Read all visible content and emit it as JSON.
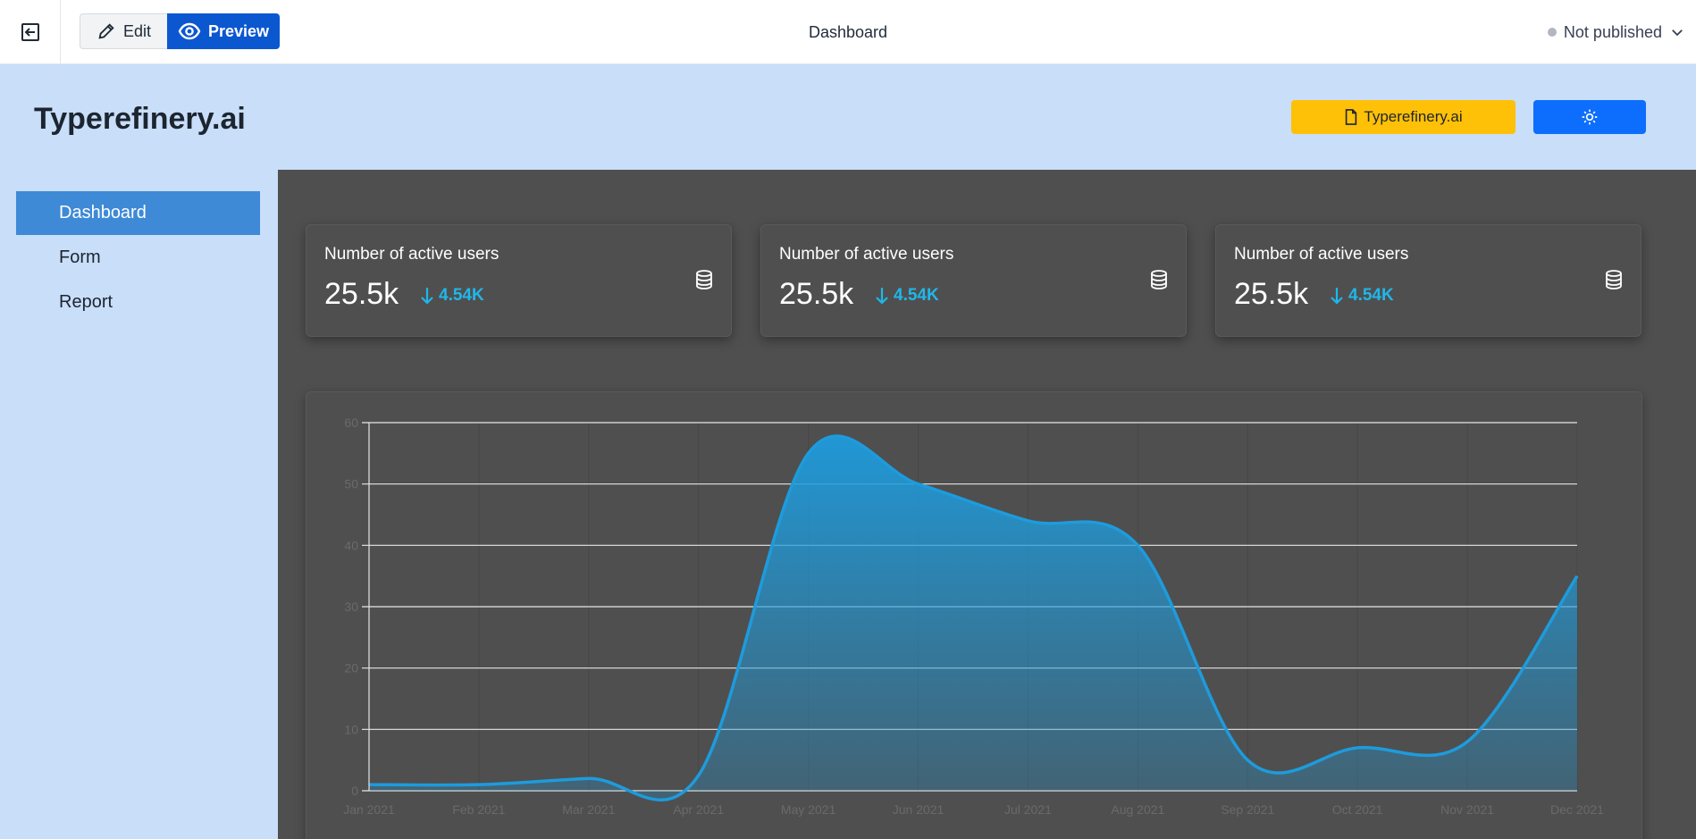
{
  "toolbar": {
    "edit_label": "Edit",
    "preview_label": "Preview",
    "page_title": "Dashboard",
    "publish_status": "Not published"
  },
  "header": {
    "app_title": "Typerefinery.ai",
    "doc_button_label": "Typerefinery.ai"
  },
  "sidebar": {
    "items": [
      {
        "label": "Dashboard",
        "active": true
      },
      {
        "label": "Form",
        "active": false
      },
      {
        "label": "Report",
        "active": false
      }
    ]
  },
  "stats": [
    {
      "label": "Number of active users",
      "value": "25.5k",
      "trend": "4.54K",
      "icon": "database-icon"
    },
    {
      "label": "Number of active users",
      "value": "25.5k",
      "trend": "4.54K",
      "icon": "database-icon"
    },
    {
      "label": "Number of active users",
      "value": "25.5k",
      "trend": "4.54K",
      "icon": "database-icon"
    }
  ],
  "colors": {
    "accent": "#0b57d0",
    "doc_button": "#ffc107",
    "theme_button": "#0d6efd",
    "trend": "#1fb7ea",
    "series_line": "#1e9bdc"
  },
  "icons": {
    "exit": "exit-icon",
    "edit": "pencil-icon",
    "preview": "eye-icon",
    "publish": "chevron-down-icon",
    "doc": "file-icon",
    "theme": "sun-icon"
  },
  "chart_data": {
    "type": "area",
    "categories": [
      "Jan 2021",
      "Feb 2021",
      "Mar 2021",
      "Apr 2021",
      "May 2021",
      "Jun 2021",
      "Jul 2021",
      "Aug 2021",
      "Sep 2021",
      "Oct 2021",
      "Nov 2021",
      "Dec 2021"
    ],
    "series": [
      {
        "values": [
          1,
          1,
          2,
          2.5,
          55,
          50,
          44,
          40,
          5,
          7,
          8,
          35
        ]
      }
    ],
    "yticks": [
      0,
      10,
      20,
      30,
      40,
      50,
      60
    ],
    "ylim": [
      0,
      60
    ],
    "grid": true,
    "title": "",
    "xlabel": "",
    "ylabel": ""
  }
}
